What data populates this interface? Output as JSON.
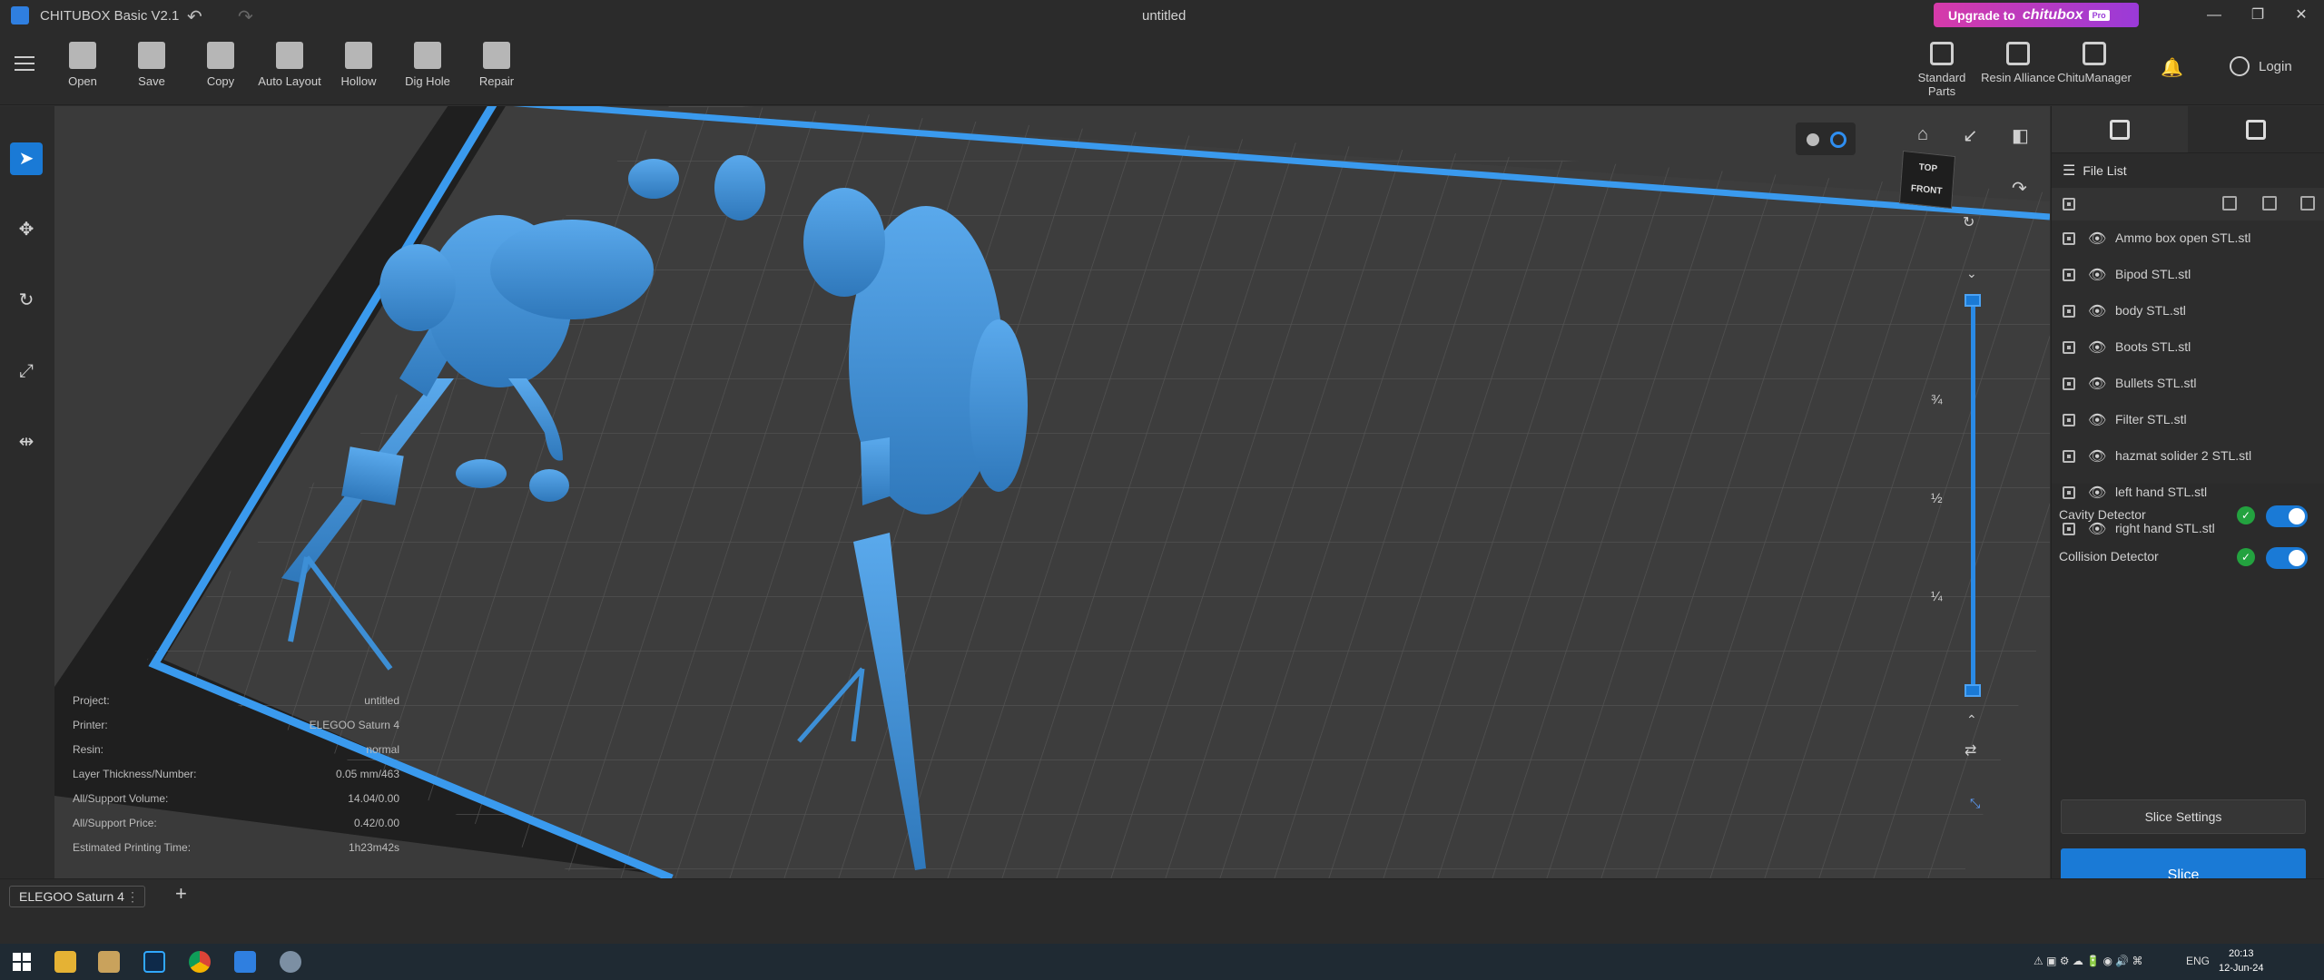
{
  "titlebar": {
    "app_title": "CHITUBOX Basic V2.1",
    "document_title": "untitled",
    "upgrade_label": "Upgrade to",
    "upgrade_brand": "chitubox",
    "upgrade_badge": "Pro",
    "minimize": "—",
    "maximize": "❐",
    "close": "✕"
  },
  "toolbar": {
    "tools": [
      {
        "label": "Open",
        "icon": "folder-icon"
      },
      {
        "label": "Save",
        "icon": "save-icon"
      },
      {
        "label": "Copy",
        "icon": "copy-icon"
      },
      {
        "label": "Auto Layout",
        "icon": "auto-layout-icon"
      },
      {
        "label": "Hollow",
        "icon": "hollow-icon"
      },
      {
        "label": "Dig Hole",
        "icon": "dig-hole-icon"
      },
      {
        "label": "Repair",
        "icon": "repair-icon"
      }
    ],
    "right_tools": [
      {
        "label": "Standard Parts",
        "icon": "standard-parts-icon"
      },
      {
        "label": "Resin Alliance",
        "icon": "resin-alliance-icon"
      },
      {
        "label": "ChituManager",
        "icon": "chitumanager-icon"
      }
    ],
    "login_label": "Login"
  },
  "left_tools": [
    "select-icon",
    "move-icon",
    "rotate-icon",
    "scale-icon",
    "mirror-icon"
  ],
  "viewport": {
    "cube_top": "TOP",
    "cube_front": "FRONT",
    "fractions": [
      "¾",
      "½",
      "¼"
    ],
    "info": [
      {
        "label": "Project:",
        "value": "untitled"
      },
      {
        "label": "Printer:",
        "value": "ELEGOO Saturn 4"
      },
      {
        "label": "Resin:",
        "value": "normal"
      },
      {
        "label": "Layer Thickness/Number:",
        "value": "0.05 mm/463"
      },
      {
        "label": "All/Support Volume:",
        "value": "14.04/0.00"
      },
      {
        "label": "All/Support Price:",
        "value": "0.42/0.00"
      },
      {
        "label": "Estimated Printing Time:",
        "value": "1h23m42s"
      }
    ]
  },
  "right_panel": {
    "file_list_title": "File List",
    "files": [
      "Ammo box open STL.stl",
      "Bipod STL.stl",
      "body STL.stl",
      "Boots STL.stl",
      "Bullets STL.stl",
      "Filter STL.stl",
      "hazmat solider 2 STL.stl",
      "left hand STL.stl",
      "right hand STL.stl"
    ],
    "cavity_detector": "Cavity Detector",
    "collision_detector": "Collision Detector",
    "slice_settings": "Slice Settings",
    "slice": "Slice"
  },
  "printer_bar": {
    "printer_tab": "ELEGOO Saturn 4",
    "add": "+"
  },
  "taskbar": {
    "language": "ENG",
    "time": "20:13",
    "date": "12-Jun-24"
  },
  "colors": {
    "accent": "#1a7ad6",
    "model": "#3d8fd6",
    "plate_edge": "#3a9aee"
  }
}
